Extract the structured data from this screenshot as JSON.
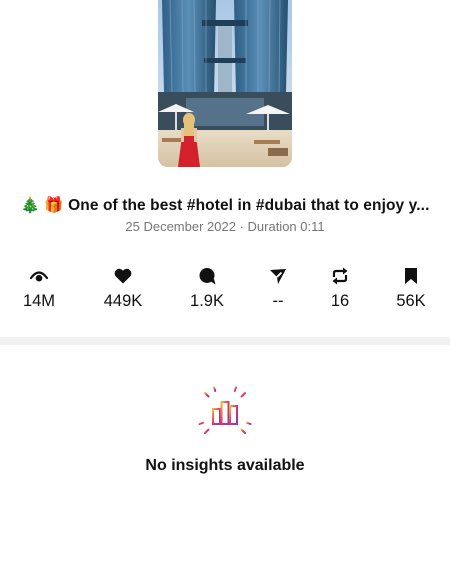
{
  "post": {
    "caption": "🎄 🎁 One of the best #hotel in #dubai that to enjoy y...",
    "meta": "25 December 2022 · Duration 0:11"
  },
  "stats": [
    {
      "name": "views",
      "icon": "eye-icon",
      "value": "14M"
    },
    {
      "name": "likes",
      "icon": "heart-icon",
      "value": "449K"
    },
    {
      "name": "comments",
      "icon": "comment-icon",
      "value": "1.9K"
    },
    {
      "name": "shares",
      "icon": "send-icon",
      "value": "--"
    },
    {
      "name": "reposts",
      "icon": "repost-icon",
      "value": "16"
    },
    {
      "name": "saves",
      "icon": "bookmark-icon",
      "value": "56K"
    }
  ],
  "insights": {
    "empty_message": "No insights available",
    "icon": "bar-chart-icon"
  },
  "colors": {
    "divider": "#f1f1f1",
    "meta_text": "#777777",
    "gradient": [
      "#f7b733",
      "#e1306c",
      "#8a3ab9"
    ]
  }
}
